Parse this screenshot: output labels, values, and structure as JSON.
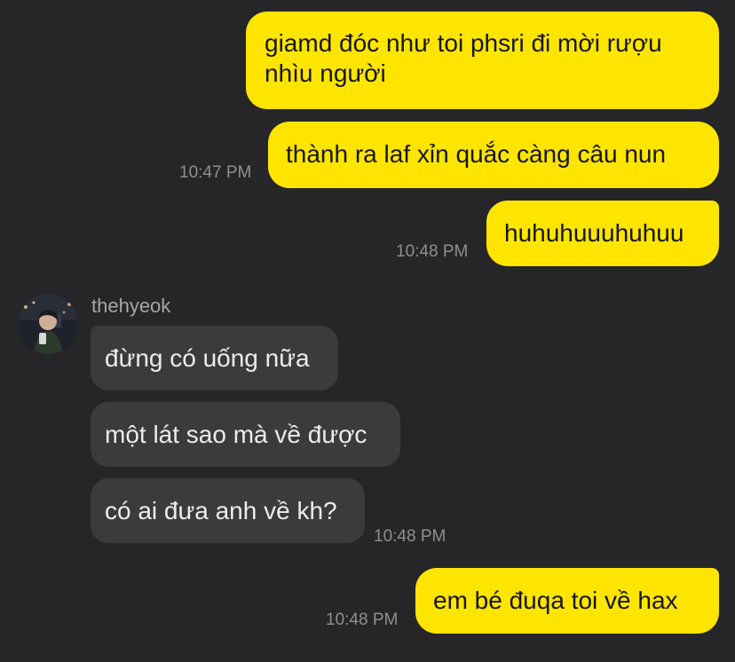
{
  "messages": [
    {
      "id": "m1",
      "direction": "outgoing",
      "text_line1": "giamd đóc như toi phsri đi mời rượu",
      "text_line2": "nhìu người"
    },
    {
      "id": "m2",
      "direction": "outgoing",
      "text": "thành ra laf xỉn quắc càng câu nun",
      "time": "10:47 PM"
    },
    {
      "id": "m3",
      "direction": "outgoing",
      "text": "huhuhuuuhuhuu",
      "time": "10:48 PM"
    },
    {
      "id": "m4",
      "direction": "incoming",
      "sender": "thehyeok",
      "text": "đừng có uống nữa"
    },
    {
      "id": "m5",
      "direction": "incoming",
      "text": "một lát sao mà về được"
    },
    {
      "id": "m6",
      "direction": "incoming",
      "text": "có ai đưa anh về kh?",
      "time": "10:48 PM"
    },
    {
      "id": "m7",
      "direction": "outgoing",
      "text": "em bé đuqa toi về hax",
      "time": "10:48 PM"
    }
  ],
  "colors": {
    "background": "#262628",
    "outgoing_bubble": "#FEE500",
    "incoming_bubble": "#3B3B3D",
    "timestamp": "#8F8F93"
  }
}
